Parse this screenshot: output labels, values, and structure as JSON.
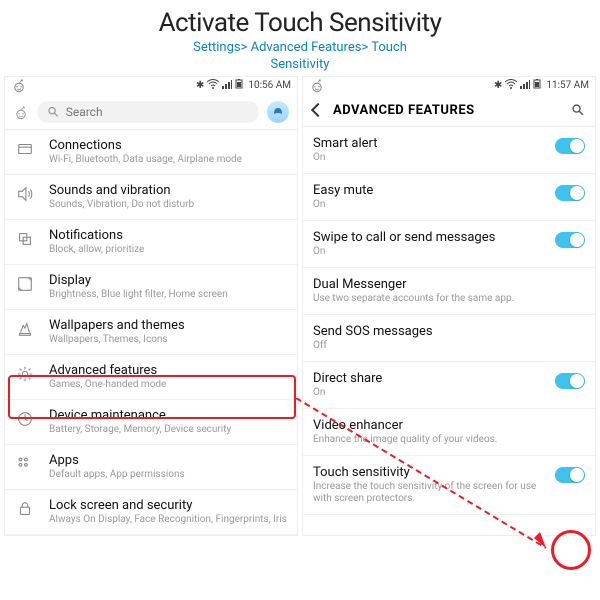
{
  "header": {
    "title": "Activate Touch Sensitivity",
    "crumb1": "Settings> Advanced Features> Touch",
    "crumb2": "Sensitivity"
  },
  "left": {
    "time": "10:56 AM",
    "search_placeholder": "Search",
    "items": [
      {
        "t": "Connections",
        "s": "Wi-Fi, Bluetooth, Data usage, Airplane mode"
      },
      {
        "t": "Sounds and vibration",
        "s": "Sounds, Vibration, Do not disturb"
      },
      {
        "t": "Notifications",
        "s": "Block, allow, prioritize"
      },
      {
        "t": "Display",
        "s": "Brightness, Blue light filter, Home screen"
      },
      {
        "t": "Wallpapers and themes",
        "s": "Wallpapers, Themes, Icons"
      },
      {
        "t": "Advanced features",
        "s": "Games, One-handed mode"
      },
      {
        "t": "Device maintenance",
        "s": "Battery, Storage, Memory, Device security"
      },
      {
        "t": "Apps",
        "s": "Default apps, App permissions"
      },
      {
        "t": "Lock screen and security",
        "s": "Always On Display, Face Recognition, Fingerprints, Iris"
      }
    ]
  },
  "right": {
    "time": "11:57 AM",
    "title": "ADVANCED FEATURES",
    "items": [
      {
        "t": "Smart alert",
        "s": "On",
        "toggle": true
      },
      {
        "t": "Easy mute",
        "s": "On",
        "toggle": true
      },
      {
        "t": "Swipe to call or send messages",
        "s": "On",
        "toggle": true
      },
      {
        "t": "Dual Messenger",
        "s": "Use two separate accounts for the same app.",
        "toggle": null
      },
      {
        "t": "Send SOS messages",
        "s": "Off",
        "toggle": null
      },
      {
        "t": "Direct share",
        "s": "On",
        "toggle": true
      },
      {
        "t": "Video enhancer",
        "s": "Enhance the image quality of your videos.",
        "toggle": null
      },
      {
        "t": "Touch sensitivity",
        "s": "Increase the touch sensitivity of the screen for use with screen protectors.",
        "toggle": true
      }
    ]
  }
}
